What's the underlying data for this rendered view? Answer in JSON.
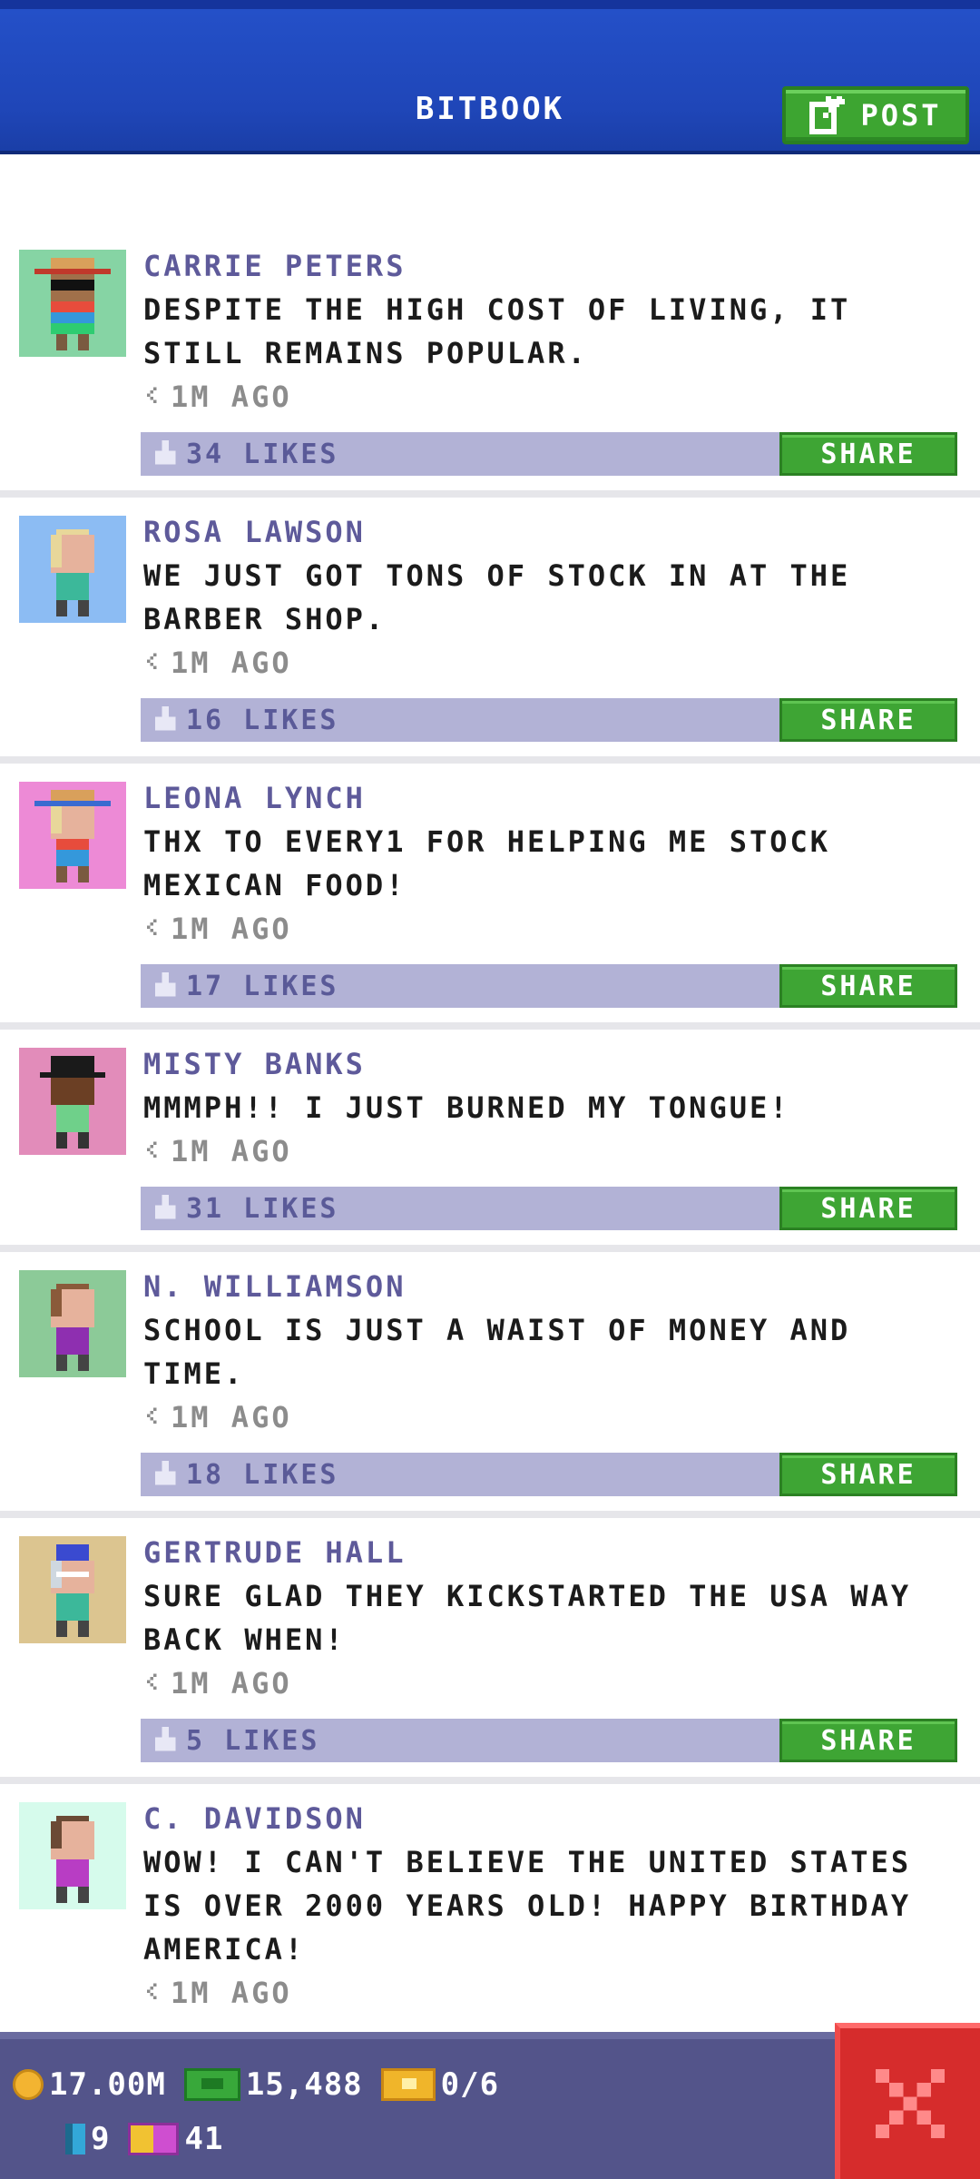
{
  "header": {
    "title": "BITBOOK",
    "post_label": "POST",
    "post_icon": "edit-icon"
  },
  "posts": [
    {
      "author": "CARRIE PETERS",
      "message": "DESPITE THE HIGH COST OF LIVING, IT STILL REMAINS POPULAR.",
      "time": "1M AGO",
      "likes": "34 LIKES",
      "share": "SHARE",
      "avatar_bg": "#86d4a4"
    },
    {
      "author": "ROSA LAWSON",
      "message": "WE JUST GOT TONS OF STOCK IN AT THE BARBER SHOP.",
      "time": "1M AGO",
      "likes": "16 LIKES",
      "share": "SHARE",
      "avatar_bg": "#8cbcf3"
    },
    {
      "author": "LEONA LYNCH",
      "message": "THX TO EVERY1 FOR HELPING ME STOCK MEXICAN FOOD!",
      "time": "1M AGO",
      "likes": "17 LIKES",
      "share": "SHARE",
      "avatar_bg": "#ed8ad6"
    },
    {
      "author": "MISTY BANKS",
      "message": "MMMPH!! I JUST BURNED MY TONGUE!",
      "time": "1M AGO",
      "likes": "31 LIKES",
      "share": "SHARE",
      "avatar_bg": "#e28cba"
    },
    {
      "author": "N. WILLIAMSON",
      "message": "SCHOOL IS JUST A WAIST OF MONEY AND TIME.",
      "time": "1M AGO",
      "likes": "18 LIKES",
      "share": "SHARE",
      "avatar_bg": "#8cca98"
    },
    {
      "author": "GERTRUDE HALL",
      "message": "SURE GLAD THEY KICKSTARTED THE USA WAY BACK WHEN!",
      "time": "1M AGO",
      "likes": "5 LIKES",
      "share": "SHARE",
      "avatar_bg": "#dcc590"
    },
    {
      "author": "C. DAVIDSON",
      "message": "WOW! I CAN'T BELIEVE THE UNITED STATES IS OVER 2000 YEARS OLD! HAPPY BIRTHDAY AMERICA!",
      "time": "1M AGO",
      "avatar_bg": "#d6fbec"
    }
  ],
  "status": {
    "coins": "17.00M",
    "bux": "15,488",
    "tickets": "0/6",
    "batteries": "9",
    "vip": "41"
  },
  "close_icon": "close-icon"
}
